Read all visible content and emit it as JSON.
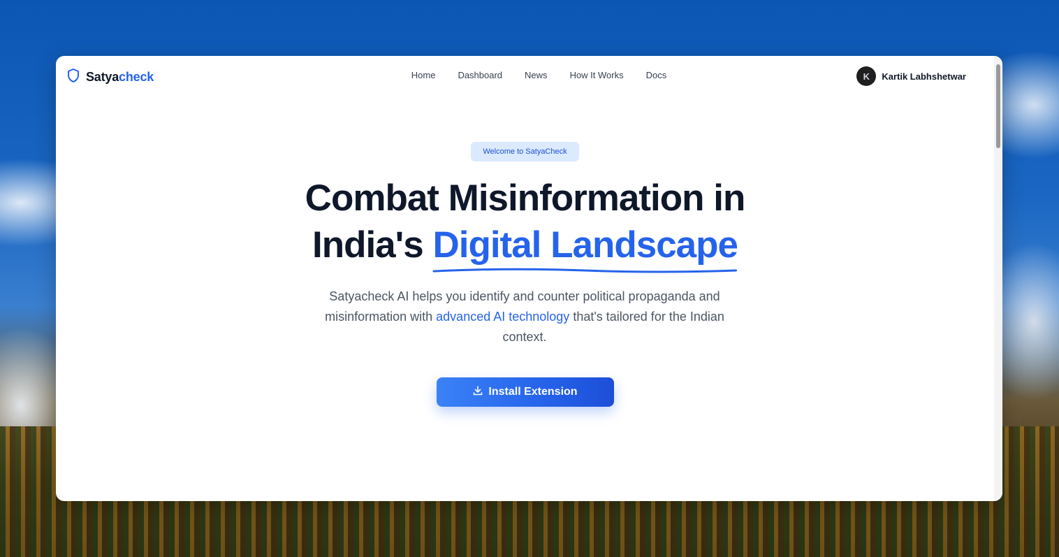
{
  "brand": {
    "name_prefix": "Satya",
    "name_suffix": "check",
    "icon": "shield-icon",
    "accent_color": "#2563eb"
  },
  "nav": {
    "items": [
      {
        "label": "Home"
      },
      {
        "label": "Dashboard"
      },
      {
        "label": "News"
      },
      {
        "label": "How It Works"
      },
      {
        "label": "Docs"
      }
    ]
  },
  "user": {
    "initial": "K",
    "name": "Kartik Labhshetwar"
  },
  "hero": {
    "badge": "Welcome to SatyaCheck",
    "headline_line1": "Combat Misinformation in",
    "headline_line2_prefix": "India's ",
    "headline_line2_accent": "Digital Landscape",
    "subtext_part1": "Satyacheck AI helps you identify and counter political propaganda and misinformation with ",
    "subtext_link": "advanced AI technology",
    "subtext_part2": " that's tailored for the Indian context.",
    "cta_label": "Install Extension",
    "cta_icon": "download-icon"
  }
}
